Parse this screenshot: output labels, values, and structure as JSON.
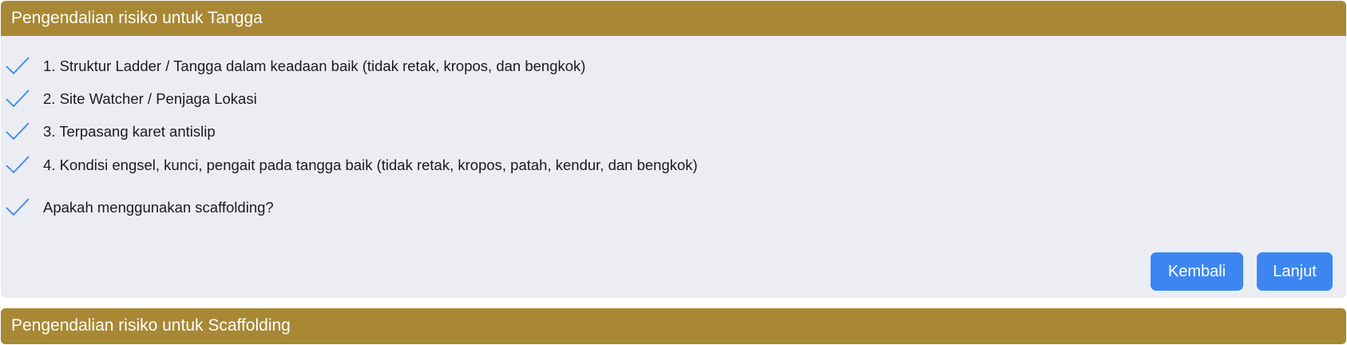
{
  "section1": {
    "title": "Pengendalian risiko untuk Tangga",
    "items": [
      {
        "label": "1. Struktur Ladder / Tangga dalam keadaan baik (tidak retak, kropos, dan bengkok)",
        "checked": true
      },
      {
        "label": "2. Site Watcher / Penjaga Lokasi",
        "checked": true
      },
      {
        "label": "3. Terpasang karet antislip",
        "checked": true
      },
      {
        "label": "4. Kondisi engsel, kunci, pengait pada tangga baik (tidak retak, kropos, patah, kendur, dan bengkok)",
        "checked": true
      }
    ],
    "question": {
      "label": "Apakah menggunakan scaffolding?",
      "checked": true
    },
    "back_label": "Kembali",
    "next_label": "Lanjut"
  },
  "section2": {
    "title": "Pengendalian risiko untuk Scaffolding"
  },
  "colors": {
    "header_bg": "#a88835",
    "panel_bg": "#ebedf3",
    "check": "#3d86f2",
    "button_bg": "#3d86f2"
  },
  "icons": {
    "check": "checkmark-icon"
  }
}
